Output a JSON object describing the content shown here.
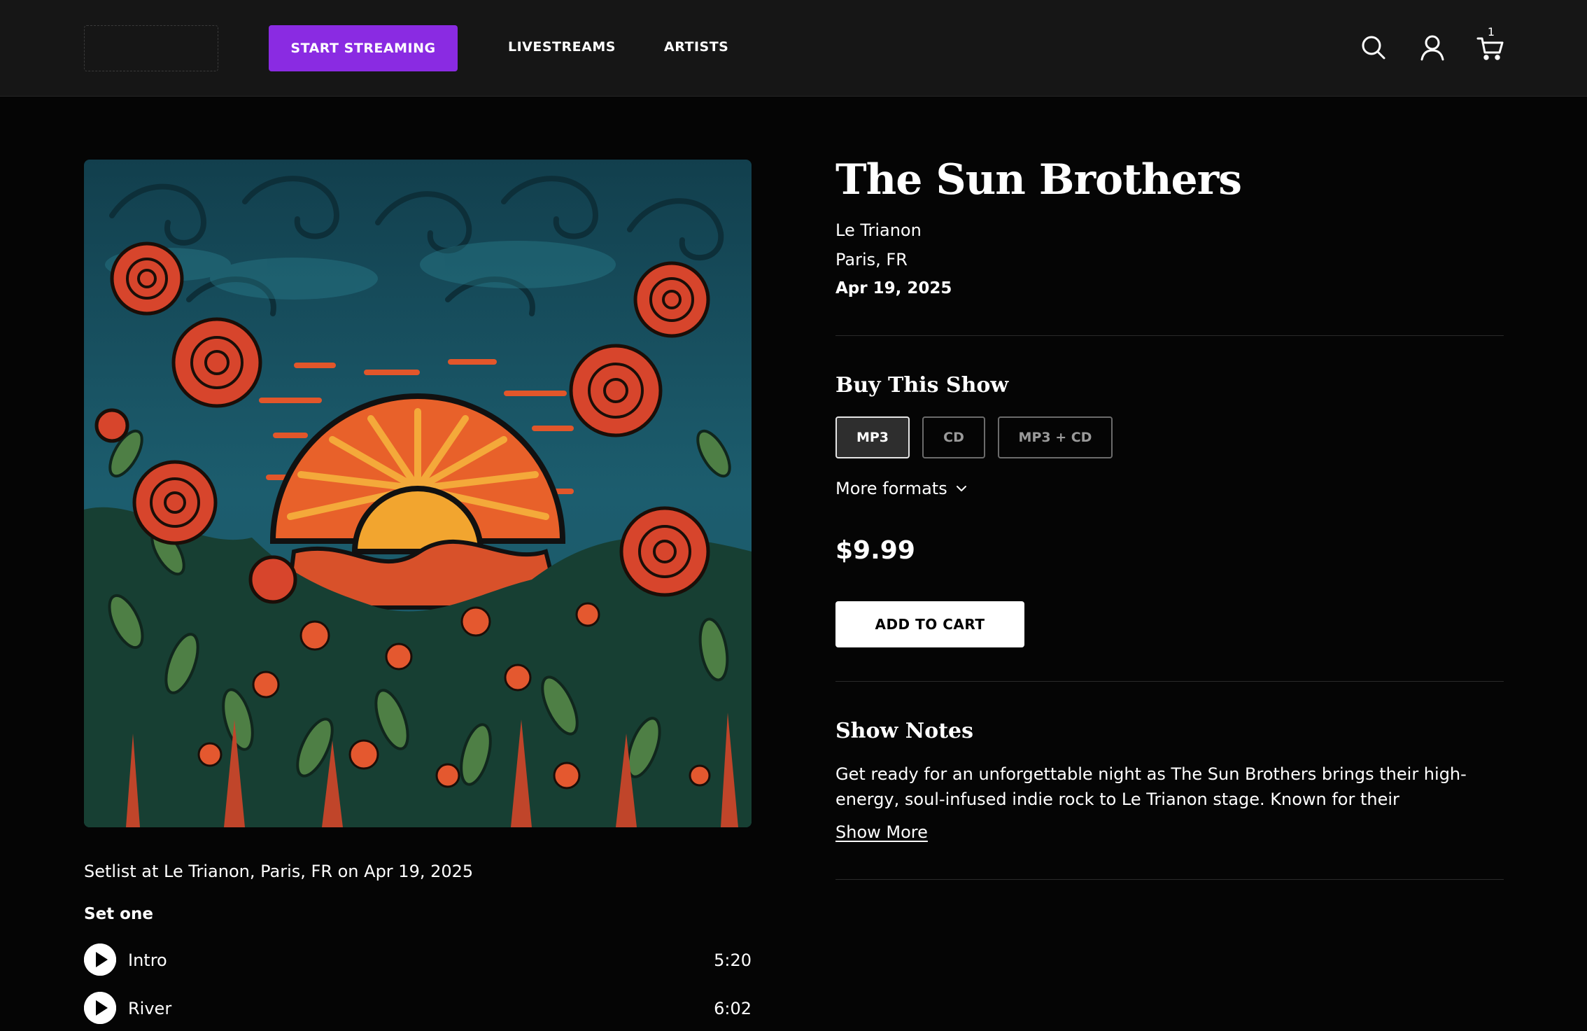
{
  "header": {
    "cta_label": "START STREAMING",
    "nav": [
      {
        "label": "LIVESTREAMS"
      },
      {
        "label": "ARTISTS"
      }
    ],
    "cart_count": "1",
    "icons": [
      "search-icon",
      "user-icon",
      "cart-icon"
    ]
  },
  "show": {
    "artist": "The Sun Brothers",
    "venue": "Le Trianon",
    "city": "Paris, FR",
    "date": "Apr 19, 2025"
  },
  "buy": {
    "title": "Buy This Show",
    "formats": [
      {
        "label": "MP3",
        "selected": true
      },
      {
        "label": "CD",
        "selected": false
      },
      {
        "label": "MP3 + CD",
        "selected": false
      }
    ],
    "more_formats_label": "More formats",
    "price": "$9.99",
    "add_to_cart_label": "ADD TO CART"
  },
  "notes": {
    "title": "Show Notes",
    "text": "Get ready for an unforgettable night as The Sun Brothers brings their high-energy, soul-infused indie rock to Le Trianon stage. Known for their electrifyin....",
    "show_more_label": "Show More"
  },
  "setlist": {
    "title": "Setlist at Le Trianon, Paris, FR on Apr 19, 2025",
    "set_name": "Set one",
    "tracks": [
      {
        "name": "Intro",
        "duration": "5:20"
      },
      {
        "name": "River",
        "duration": "6:02"
      }
    ]
  },
  "colors": {
    "accent": "#8a2be2",
    "header_bg": "#161616",
    "page_bg": "#050505"
  }
}
